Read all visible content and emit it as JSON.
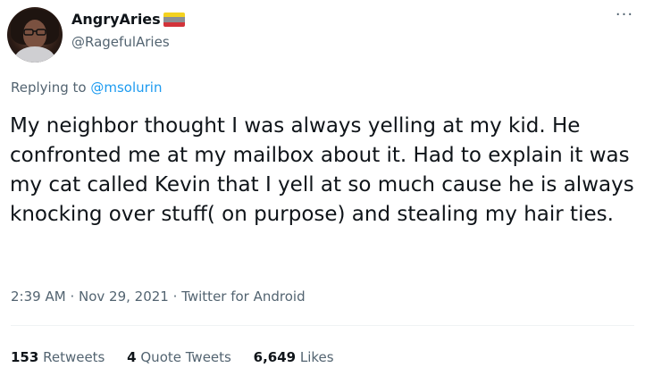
{
  "author": {
    "display_name": "AngryAries",
    "handle": "@RagefulAries",
    "flag_colors": [
      "#f4d21f",
      "#8b8f95",
      "#d2333a"
    ]
  },
  "menu": {
    "more_label": "···"
  },
  "reply": {
    "prefix": "Replying to",
    "mention": "@msolurin"
  },
  "tweet": {
    "text": "My neighbor thought I was always yelling at my kid. He confronted me at my mailbox about it. Had to explain it was my cat called Kevin that I yell at so much cause he is always knocking over stuff( on purpose) and stealing my hair ties."
  },
  "meta": {
    "time": "2:39 AM",
    "separator": "·",
    "date": "Nov 29, 2021",
    "source": "Twitter for Android"
  },
  "stats": {
    "retweets_count": "153",
    "retweets_label": "Retweets",
    "quotes_count": "4",
    "quotes_label": "Quote Tweets",
    "likes_count": "6,649",
    "likes_label": "Likes"
  },
  "colors": {
    "text_primary": "#0f1419",
    "text_secondary": "#536471",
    "link": "#1d9bf0",
    "divider": "#eff3f4"
  }
}
